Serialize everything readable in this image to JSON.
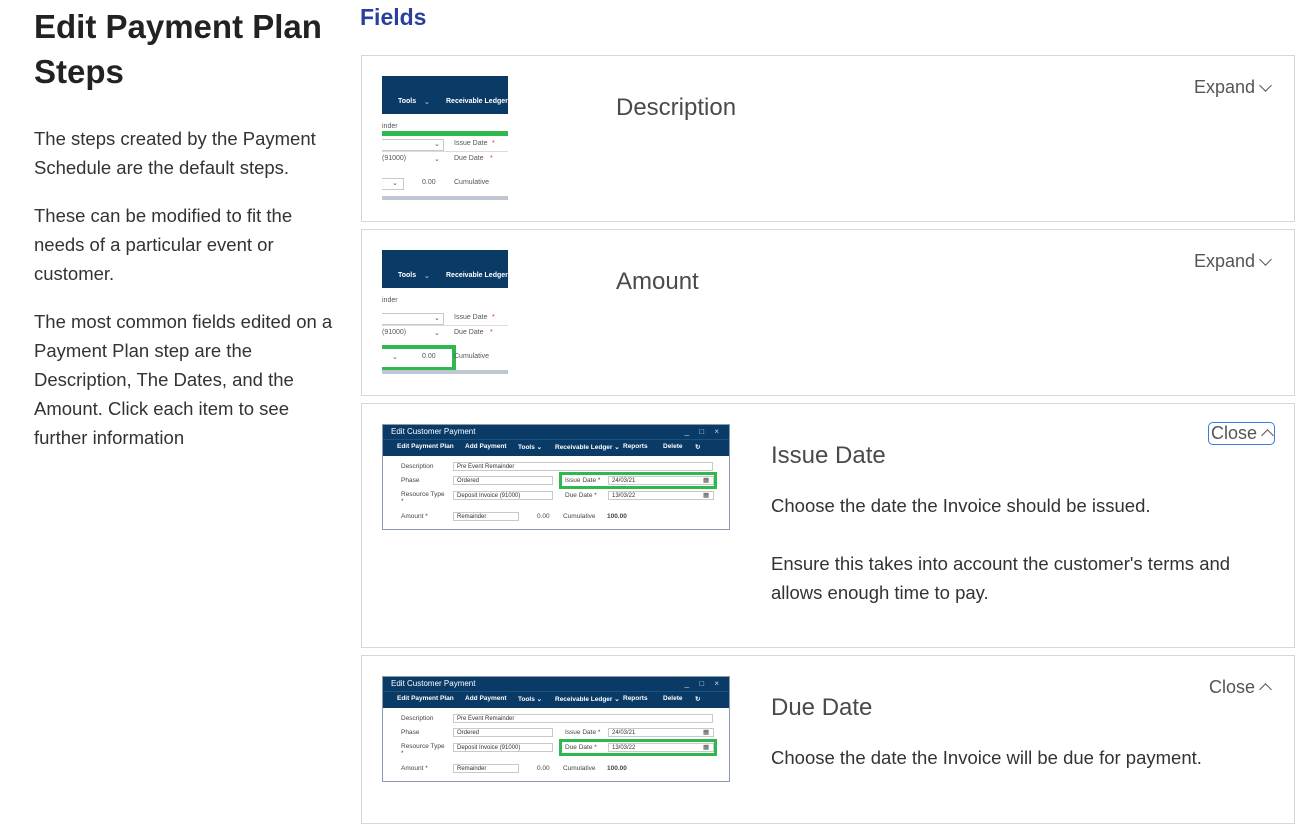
{
  "sidebar": {
    "title": "Edit Payment Plan Steps",
    "paragraphs": [
      "The steps created by the Payment Schedule are the default steps.",
      "These can be modified to fit the needs of a particular event or customer.",
      "The most common fields edited on a Payment Plan step are the Description, The Dates, and the Amount. Click each item to see further information"
    ]
  },
  "fields_title": "Fields",
  "cards": [
    {
      "title": "Description",
      "toggle": "Expand",
      "state": "collapsed"
    },
    {
      "title": "Amount",
      "toggle": "Expand",
      "state": "collapsed"
    },
    {
      "title": "Issue Date",
      "toggle": "Close",
      "state": "expanded",
      "desc1": "Choose the date the Invoice should be issued.",
      "desc2": "Ensure this takes into account the customer's terms and allows enough time to pay."
    },
    {
      "title": "Due Date",
      "toggle": "Close",
      "state": "expanded",
      "desc1": "Choose the date the Invoice will be due for payment."
    }
  ],
  "thumb_crop": {
    "toolbar": [
      "Tools",
      "Receivable Ledger"
    ],
    "row0": "inder",
    "row1_label": "Issue Date",
    "row2_value": "(91000)",
    "row2_label": "Due Date",
    "row3_value": "0.00",
    "row3_label": "Cumulative",
    "required": "*",
    "dropdown": "⌄"
  },
  "thumb_full": {
    "window_title": "Edit Customer Payment",
    "window_controls": "_ □ ×",
    "toolbar": [
      "Edit Payment Plan",
      "Add Payment",
      "Tools ⌄",
      "Receivable Ledger ⌄",
      "Reports",
      "Delete",
      "↻"
    ],
    "labels": {
      "description": "Description",
      "phase": "Phase",
      "resource_type": "Resource Type *",
      "amount": "Amount *",
      "issue_date": "Issue Date *",
      "due_date": "Due Date *",
      "cumulative": "Cumulative"
    },
    "values": {
      "description": "Pre Event Remainder",
      "phase": "Ordered",
      "resource_type": "Deposit Invoice (91000)",
      "amount_type": "Remainder",
      "amount": "0.00",
      "issue_date": "24/03/21",
      "due_date": "13/03/22",
      "cumulative": "100.00"
    },
    "calendar_icon": "▦"
  },
  "colors": {
    "accent": "#2b3f9c",
    "toolbar": "#0a3a66",
    "highlight": "#2fb84e",
    "focus_ring": "#3b7be0"
  }
}
